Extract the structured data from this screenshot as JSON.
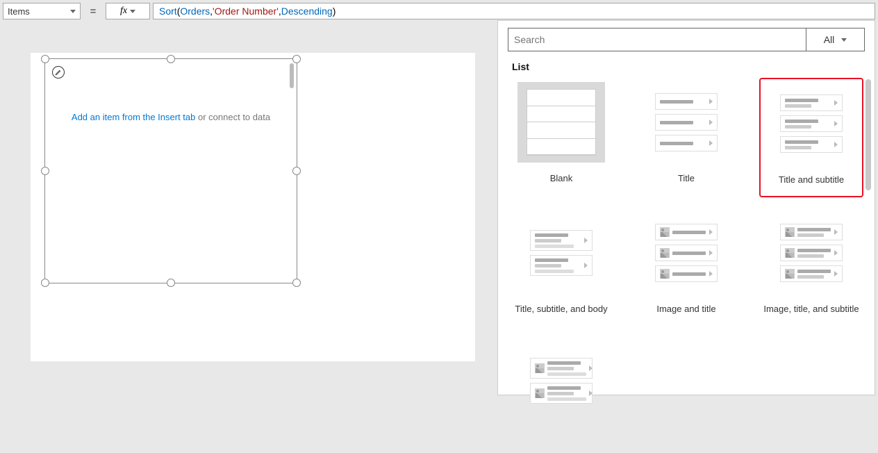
{
  "formula": {
    "property_label": "Items",
    "equals": "=",
    "fx": "fx",
    "tokens": {
      "sort": "Sort",
      "open": "( ",
      "orders": "Orders",
      "c1": ", ",
      "order_number": "'Order Number'",
      "c2": ", ",
      "desc": "Descending",
      "close": " )"
    }
  },
  "canvas": {
    "hint_link": "Add an item from the Insert tab",
    "hint_rest": " or connect to data"
  },
  "panel": {
    "search_placeholder": "Search",
    "filter_label": "All",
    "section": "List",
    "tiles": {
      "blank": "Blank",
      "title": "Title",
      "title_subtitle": "Title and subtitle",
      "tsb": "Title, subtitle, and body",
      "image_title": "Image and title",
      "its": "Image, title, and subtitle"
    }
  }
}
